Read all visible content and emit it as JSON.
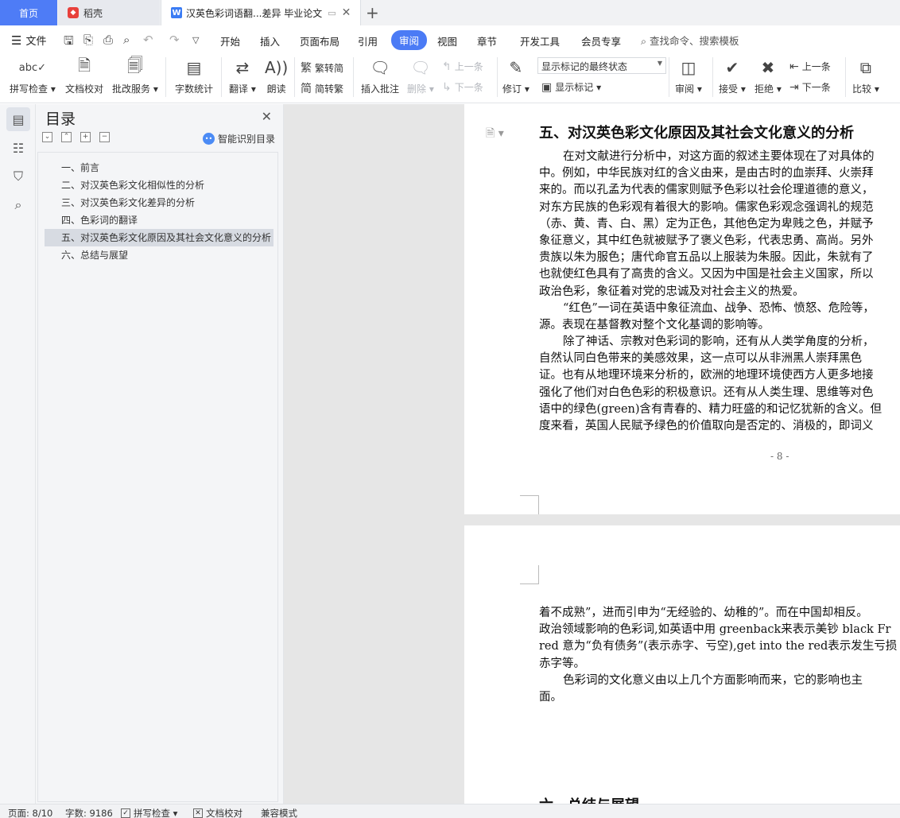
{
  "tabs": {
    "home": "首页",
    "daoke": "稻壳",
    "document": "汉英色彩词语翻...差异 毕业论文",
    "new_tab": "+"
  },
  "menu": {
    "file": "文件",
    "items": [
      "开始",
      "插入",
      "页面布局",
      "引用",
      "审阅",
      "视图",
      "章节",
      "开发工具",
      "会员专享"
    ],
    "active": "审阅",
    "search": "查找命令、搜索模板"
  },
  "ribbon": {
    "spell_check": "拼写检查",
    "doc_proof": "文档校对",
    "correction_service": "批改服务",
    "word_count": "字数统计",
    "translate": "翻译",
    "read_aloud": "朗读",
    "to_traditional": "繁转简",
    "to_simplified": "简转繁",
    "insert_comment": "插入批注",
    "delete": "删除",
    "prev_comment": "上一条",
    "next_comment": "下一条",
    "revise": "修订",
    "markup_mode": "显示标记的最终状态",
    "show_markup": "显示标记",
    "review": "审阅",
    "accept": "接受",
    "reject": "拒绝",
    "prev_change": "上一条",
    "next_change": "下一条",
    "compare": "比较"
  },
  "nav": {
    "title": "目录",
    "smart_toc": "智能识别目录",
    "items": [
      "一、前言",
      "二、对汉英色彩文化相似性的分析",
      "三、对汉英色彩文化差异的分析",
      "四、色彩词的翻译",
      "五、对汉英色彩文化原因及其社会文化意义的分析",
      "六、总结与展望"
    ],
    "active_index": 4
  },
  "document": {
    "page1": {
      "heading": "五、对汉英色彩文化原因及其社会文化意义的分析",
      "lines": [
        "在对文献进行分析中，对这方面的叙述主要体现在了对具体的",
        "中。例如，中华民族对红的含义由来，是由古时的血崇拜、火崇拜",
        "来的。而以孔孟为代表的儒家则赋予色彩以社会伦理道德的意义，",
        "对东方民族的色彩观有着很大的影响。儒家色彩观念强调礼的规范",
        "（赤、黄、青、白、黑）定为正色，其他色定为卑贱之色，并赋予",
        "象征意义，其中红色就被赋予了褒义色彩，代表忠勇、高尚。另外",
        "贵族以朱为服色；唐代命官五品以上服装为朱服。因此，朱就有了",
        "也就使红色具有了高贵的含义。又因为中国是社会主义国家，所以",
        "政治色彩，象征着对党的忠诚及对社会主义的热爱。",
        "“红色”一词在英语中象征流血、战争、恐怖、愤怒、危险等，",
        "源。表现在基督教对整个文化基调的影响等。",
        "除了神话、宗教对色彩词的影响，还有从人类学角度的分析，",
        "自然认同白色带来的美感效果，这一点可以从非洲黑人崇拜黑色",
        "证。也有从地理环境来分析的，欧洲的地理环境使西方人更多地接",
        "强化了他们对白色色彩的积极意识。还有从人类生理、思维等对色",
        "语中的绿色(green)含有青春的、精力旺盛的和记忆犹新的含义。但",
        "度来看，英国人民赋予绿色的价值取向是否定的、消极的，即词义"
      ],
      "page_number": "- 8 -"
    },
    "page2": {
      "lines": [
        "着不成熟”，进而引申为“无经验的、幼稚的”。而在中国却相反。",
        "政治领域影响的色彩词,如英语中用 greenback来表示美钞 black Fr",
        "red 意为“负有债务”(表示赤字、亏空),get into the red表示发生亏损",
        "赤字等。",
        "色彩词的文化意义由以上几个方面影响而来，它的影响也主",
        "面。"
      ],
      "next_heading": "六、总结与展望"
    }
  },
  "status": {
    "page": "页面: 8/10",
    "word_count": "字数: 9186",
    "spell_check": "拼写检查",
    "doc_proof": "文档校对",
    "compat_mode": "兼容模式"
  }
}
